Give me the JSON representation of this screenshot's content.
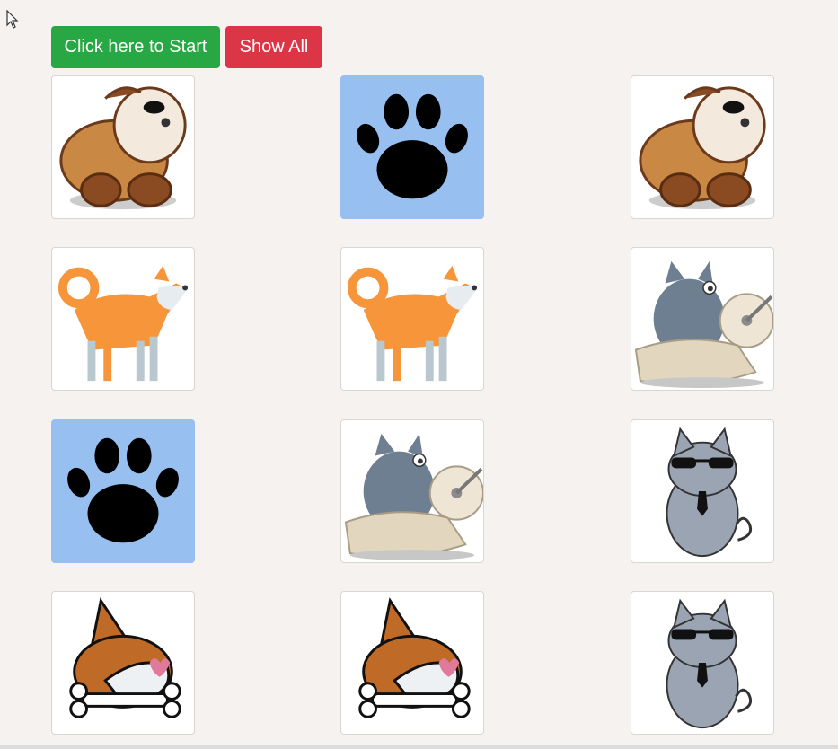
{
  "buttons": {
    "start": "Click here to Start",
    "show_all": "Show All"
  },
  "colors": {
    "start": "#28a745",
    "show_all": "#dc3545",
    "paw_background": "#97bff0",
    "page_background": "#f5f2ef"
  },
  "cards": [
    {
      "icon": "bulldog-icon"
    },
    {
      "icon": "paw-icon"
    },
    {
      "icon": "bulldog-icon"
    },
    {
      "icon": "shiba-icon"
    },
    {
      "icon": "shiba-icon"
    },
    {
      "icon": "cat-toilet-paper-icon"
    },
    {
      "icon": "paw-icon"
    },
    {
      "icon": "cat-toilet-paper-icon"
    },
    {
      "icon": "cool-cat-icon"
    },
    {
      "icon": "corgi-bone-icon"
    },
    {
      "icon": "corgi-bone-icon"
    },
    {
      "icon": "cool-cat-icon"
    }
  ]
}
